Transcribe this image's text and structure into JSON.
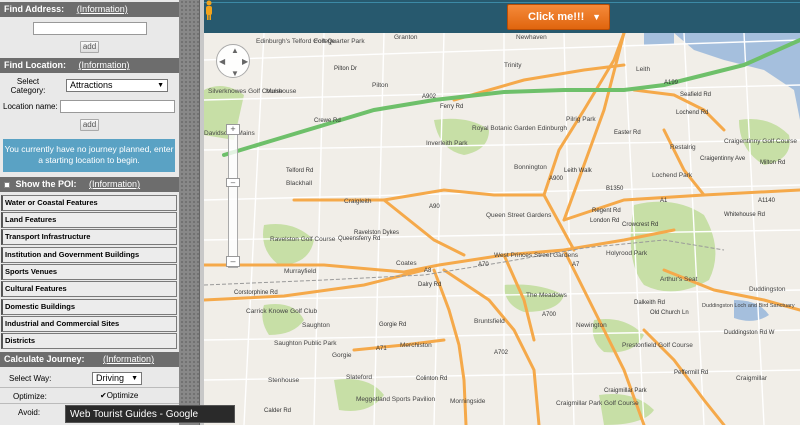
{
  "find_address": {
    "title": "Find Address:",
    "info": "(Information)",
    "input_value": "",
    "add_label": "add"
  },
  "find_location": {
    "title": "Find Location:",
    "info": "(Information)",
    "category_label": "Select Category:",
    "category_value": "Attractions",
    "name_label": "Location name:",
    "name_value": "",
    "add_label": "add"
  },
  "journey_message": "You currently have no journey planned, enter a starting location to begin.",
  "poi": {
    "title": "Show the POI:",
    "info": "(Information)",
    "items": [
      "Water or Coastal Features",
      "Land Features",
      "Transport Infrastructure",
      "Institution and Government Buildings",
      "Sports Venues",
      "Cultural Features",
      "Domestic Buildings",
      "Industrial and Commercial Sites",
      "Districts"
    ]
  },
  "journey": {
    "title": "Calculate Journey:",
    "info": "(Information)",
    "way_label": "Select Way:",
    "way_value": "Driving",
    "optimize_label": "Optimize:",
    "optimize_checkbox_label": "Optimize",
    "avoid_label": "Avoid:"
  },
  "map": {
    "click_me": "Click me!!!",
    "places": [
      "Edinburgh's Telford College",
      "Fort Quarter Park",
      "Granton",
      "Newhaven",
      "Trinity",
      "Leith",
      "Silverknowes Golf Course",
      "Muirhouse",
      "Pilton",
      "Davidson's Mains",
      "Royal Botanic Garden Edinburgh",
      "Inverleith Park",
      "Pilrig Park",
      "Bonnington",
      "Lochend Park",
      "Restalrig",
      "Craigentinny Golf Course",
      "Blackhall",
      "Craigleith",
      "Queen Street Gardens",
      "West Princes Street Gardens",
      "Coates",
      "Ravelston Golf Course",
      "Murrayfield",
      "Holyrood Park",
      "Arthur's Seat",
      "Duddingston",
      "Duddingston Loch and Bird Sanctuary",
      "Newington",
      "The Meadows",
      "Bruntsfield",
      "Carrick Knowe Golf Club",
      "Saughton",
      "Saughton Public Park",
      "Gorgie",
      "Merchiston",
      "Slateford",
      "Prestonfield Golf Course",
      "Craigmillar",
      "Stenhouse",
      "Meggetland Sports Pavilion",
      "Morningside",
      "Craigmillar Park Golf Course"
    ],
    "roads": [
      "A902",
      "Ferry Rd",
      "A90",
      "A8",
      "A70",
      "A700",
      "A7",
      "A1",
      "A1140",
      "B1350",
      "Telford Rd",
      "Queensferry Rd",
      "Pilton Dr",
      "Crewe Rd",
      "Easter Rd",
      "Leith Walk",
      "London Rd",
      "Regent Rd",
      "Crowcrest Rd",
      "Dalry Rd",
      "Gorgie Rd",
      "Colinton Rd",
      "Whitehouse Rd",
      "Milton Rd",
      "Craigentinny Ave",
      "Lochend Rd",
      "Seafield Rd",
      "A199",
      "A900",
      "A71",
      "A702",
      "Ravelston Dykes",
      "Corstorphine Rd",
      "Calder Rd",
      "Old Church Ln",
      "Peffermill Rd",
      "Duddingston Rd W",
      "Craigmillar Park",
      "Dalkeith Rd"
    ],
    "zoom_plus": "+",
    "zoom_minus": "–"
  },
  "tooltip": "Web Tourist Guides - Google Chrome",
  "colors": {
    "panel_header": "#6d6d6d",
    "panel_bg": "#e9e9e9",
    "message_bg": "#5aa2c4",
    "accent_button": "#e86f17",
    "map_road_major": "#f5a94a",
    "map_road_green": "#6ec06a",
    "map_park": "#c7dfa6",
    "map_water": "#a5bfdd"
  }
}
